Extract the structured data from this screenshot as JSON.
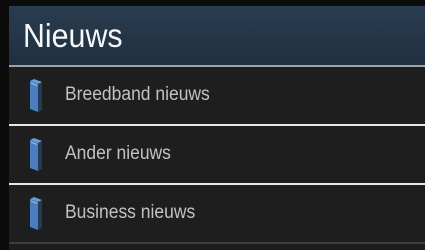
{
  "header": {
    "title": "Nieuws"
  },
  "items": [
    {
      "label": "Breedband nieuws",
      "icon": "folder-icon"
    },
    {
      "label": "Ander nieuws",
      "icon": "folder-icon"
    },
    {
      "label": "Business nieuws",
      "icon": "folder-icon"
    }
  ],
  "colors": {
    "header_bg": "#24364a",
    "item_bg": "#1e1e1e",
    "label_text": "#c2c2c2",
    "icon_accent": "#4a7ec0"
  }
}
